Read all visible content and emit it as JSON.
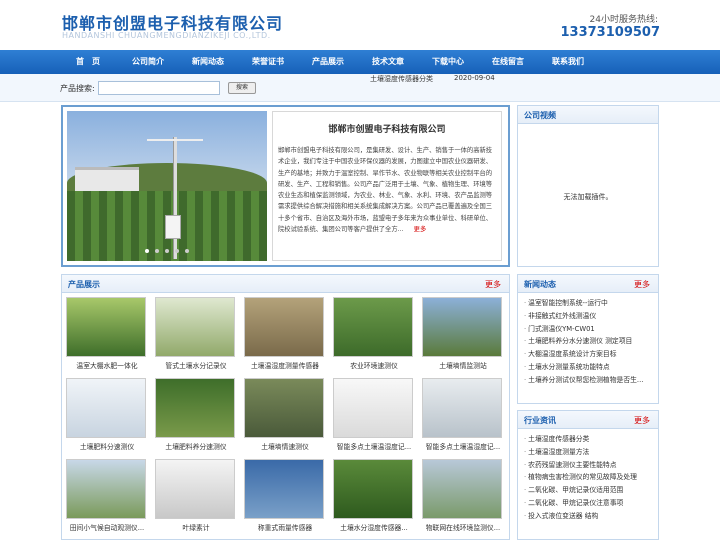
{
  "header": {
    "logo_cn": "邯郸市创盟电子科技有限公司",
    "logo_en": "HANDANSHI CHUANGMENGDIANZIKEJI CO.,LTD.",
    "hotline_label": "24小时服务热线:",
    "hotline_number": "13373109507"
  },
  "nav": [
    "首　页",
    "公司简介",
    "新闻动态",
    "荣誉证书",
    "产品展示",
    "技术文章",
    "下载中心",
    "在线留言",
    "联系我们"
  ],
  "search": {
    "label": "产品搜索:",
    "value": "",
    "button": "搜索"
  },
  "ticker": {
    "text": "土壤湿度传感器分类",
    "date": "2020-09-04"
  },
  "about": {
    "title": "邯郸市创盟电子科技有限公司",
    "body": "邯郸市创盟电子科技有限公司，是集研发、设计、生产、销售于一体的高新技术企业，我们专注于中国农业环保仪器的发展，力图建立中国农业仪器研发、生产的基地；并致力于温室控制、旱作节水、农业物联等相关农业控制平台的研发、生产、工程和销售。公司产品广泛用于土壤、气象、植物生理、环境等农业生态和植保监测领域，为农业、林业、气象、水利、环境、农产品监测等需求提供综合解决措施和相关系统集成解决方案。公司产品已覆盖遍及全国三十多个省市、自治区及海外市场，蓝盟电子多年来为众事业单位、科研单位、院校试验系统、集团公司等客户提供了全方...",
    "more": "更多"
  },
  "video": {
    "title": "公司视频",
    "msg": "无法加载插件。"
  },
  "products": {
    "title": "产品展示",
    "more": "更多",
    "items": [
      {
        "name": "温室大棚水肥一体化"
      },
      {
        "name": "管式土壤水分记录仪"
      },
      {
        "name": "土壤温湿度测量传感器"
      },
      {
        "name": "农业环境速测仪"
      },
      {
        "name": "土壤墒情监测站"
      },
      {
        "name": "土壤肥料分速测仪"
      },
      {
        "name": "土壤肥料养分速测仪"
      },
      {
        "name": "土壤墒情速测仪"
      },
      {
        "name": "智能多点土壤温湿度记..."
      },
      {
        "name": "智能多点土壤温湿度记..."
      },
      {
        "name": "田间小气候自动观测仪..."
      },
      {
        "name": "叶绿素计"
      },
      {
        "name": "称重式雨量传感器"
      },
      {
        "name": "土壤水分湿度传感器..."
      },
      {
        "name": "物联网在线环境监测仪..."
      }
    ]
  },
  "news": {
    "title": "新闻动态",
    "more": "更多",
    "items": [
      "温室智能控制系统--运行中",
      "非接触式红外线测温仪",
      "门式测温仪YM-CW01",
      "土壤肥料养分水分速测仪 测定项目",
      "大棚温湿度系统设计方案目标",
      "土壤水分测量系统功能特点",
      "土壤养分测试仪帮您检测植物是否生..."
    ]
  },
  "industry": {
    "title": "行业资讯",
    "more": "更多",
    "items": [
      "土壤湿度传感器分类",
      "土壤温湿度测量方法",
      "农药残留速测仪主要性能特点",
      "植物病虫害检测仪的常见故障及处理",
      "二氧化碳、甲烷记录仪适用范围",
      "二氧化碳、甲烷记录仪注意事项",
      "投入式液位变送器 结构"
    ]
  },
  "colors": {
    "brand": "#1c5fae",
    "nav": "#1f6cc4",
    "more": "#d40000"
  }
}
